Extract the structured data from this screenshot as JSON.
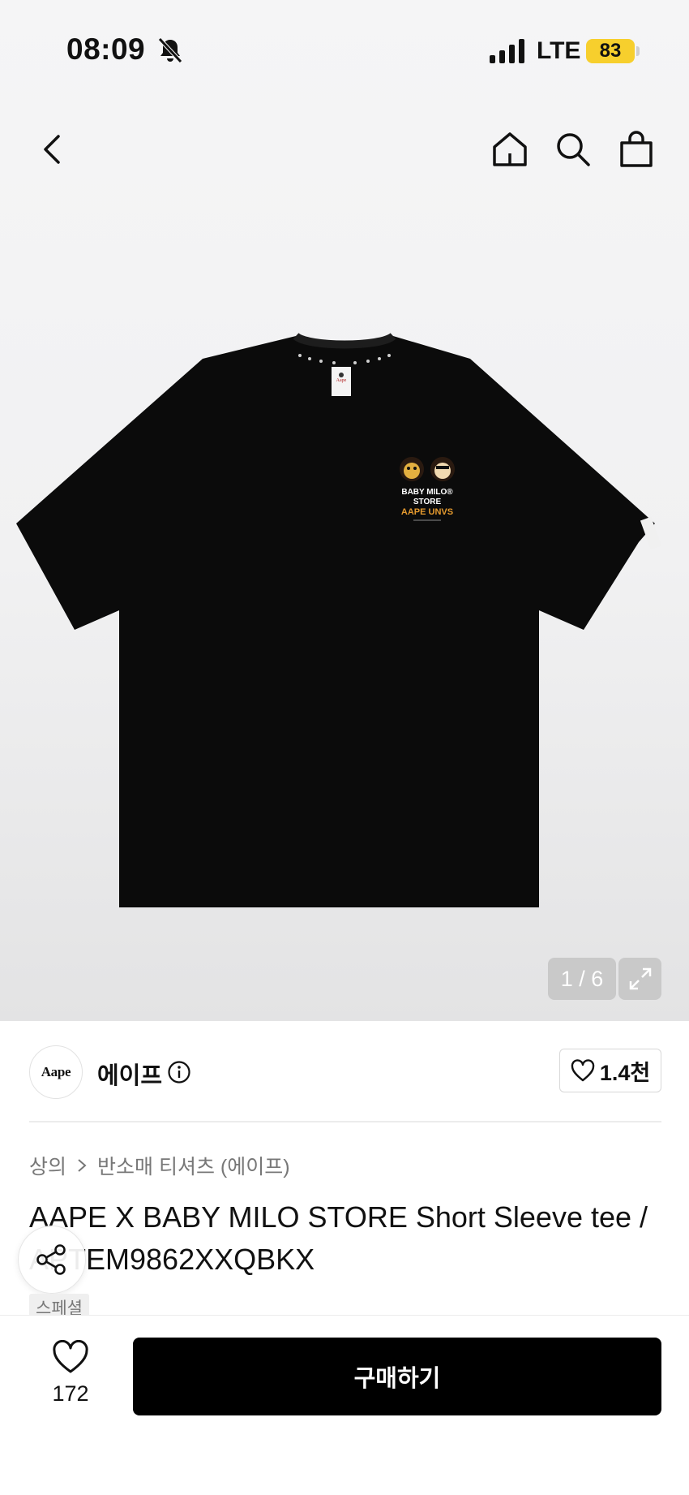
{
  "status_bar": {
    "time": "08:09",
    "network": "LTE",
    "battery": "83",
    "battery_color": "#f7cf2d"
  },
  "nav": {
    "back_icon": "chevron-left-icon",
    "home_icon": "home-icon",
    "search_icon": "search-icon",
    "bag_icon": "shopping-bag-icon"
  },
  "gallery": {
    "counter": "1 / 6",
    "expand_icon": "expand-icon",
    "garment_print": {
      "line1": "BABY MILO®",
      "line2": "STORE",
      "line3": "AAPE UNVS"
    },
    "logo_text": "Aape"
  },
  "brand": {
    "logo_text": "Aape",
    "name": "에이프",
    "like_count": "1.4천"
  },
  "breadcrumb": [
    "상의",
    "반소매 티셔츠 (에이프)"
  ],
  "product": {
    "title": "AAPE X BABY MILO STORE Short Sleeve tee / APTEM9862XXQBKX",
    "tag": "스페셜"
  },
  "bottom_bar": {
    "wish_count": "172",
    "buy_label": "구매하기",
    "buy_color": "#000000"
  }
}
